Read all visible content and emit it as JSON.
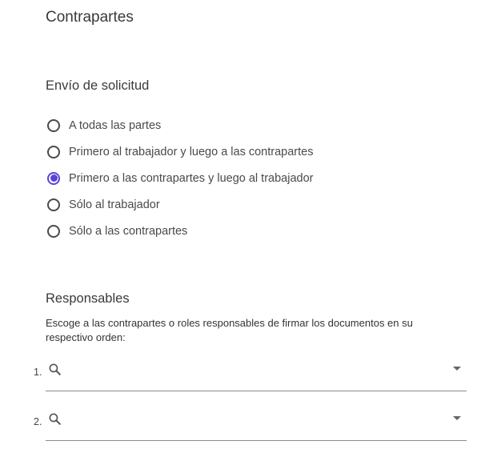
{
  "page": {
    "title": "Contrapartes"
  },
  "envio": {
    "title": "Envío de solicitud",
    "options": [
      {
        "label": "A todas las partes",
        "checked": false
      },
      {
        "label": "Primero al trabajador y luego a las contrapartes",
        "checked": false
      },
      {
        "label": "Primero a las contrapartes y luego al trabajador",
        "checked": true
      },
      {
        "label": "Sólo al trabajador",
        "checked": false
      },
      {
        "label": "Sólo a las contrapartes",
        "checked": false
      }
    ]
  },
  "responsables": {
    "title": "Responsables",
    "description": "Escoge a las contrapartes o roles responsables de firmar los documentos en su respectivo orden:",
    "pickers": [
      {
        "number": "1.",
        "value": "",
        "placeholder": ""
      },
      {
        "number": "2.",
        "value": "",
        "placeholder": ""
      }
    ]
  },
  "colors": {
    "accent": "#5a43d6",
    "text": "#3a3a3a",
    "underline": "#8a8a8a"
  },
  "icons": {
    "search": "search-icon",
    "dropdown": "chevron-down-icon",
    "radio_selected": "radio-checked-icon",
    "radio_unselected": "radio-unchecked-icon"
  }
}
